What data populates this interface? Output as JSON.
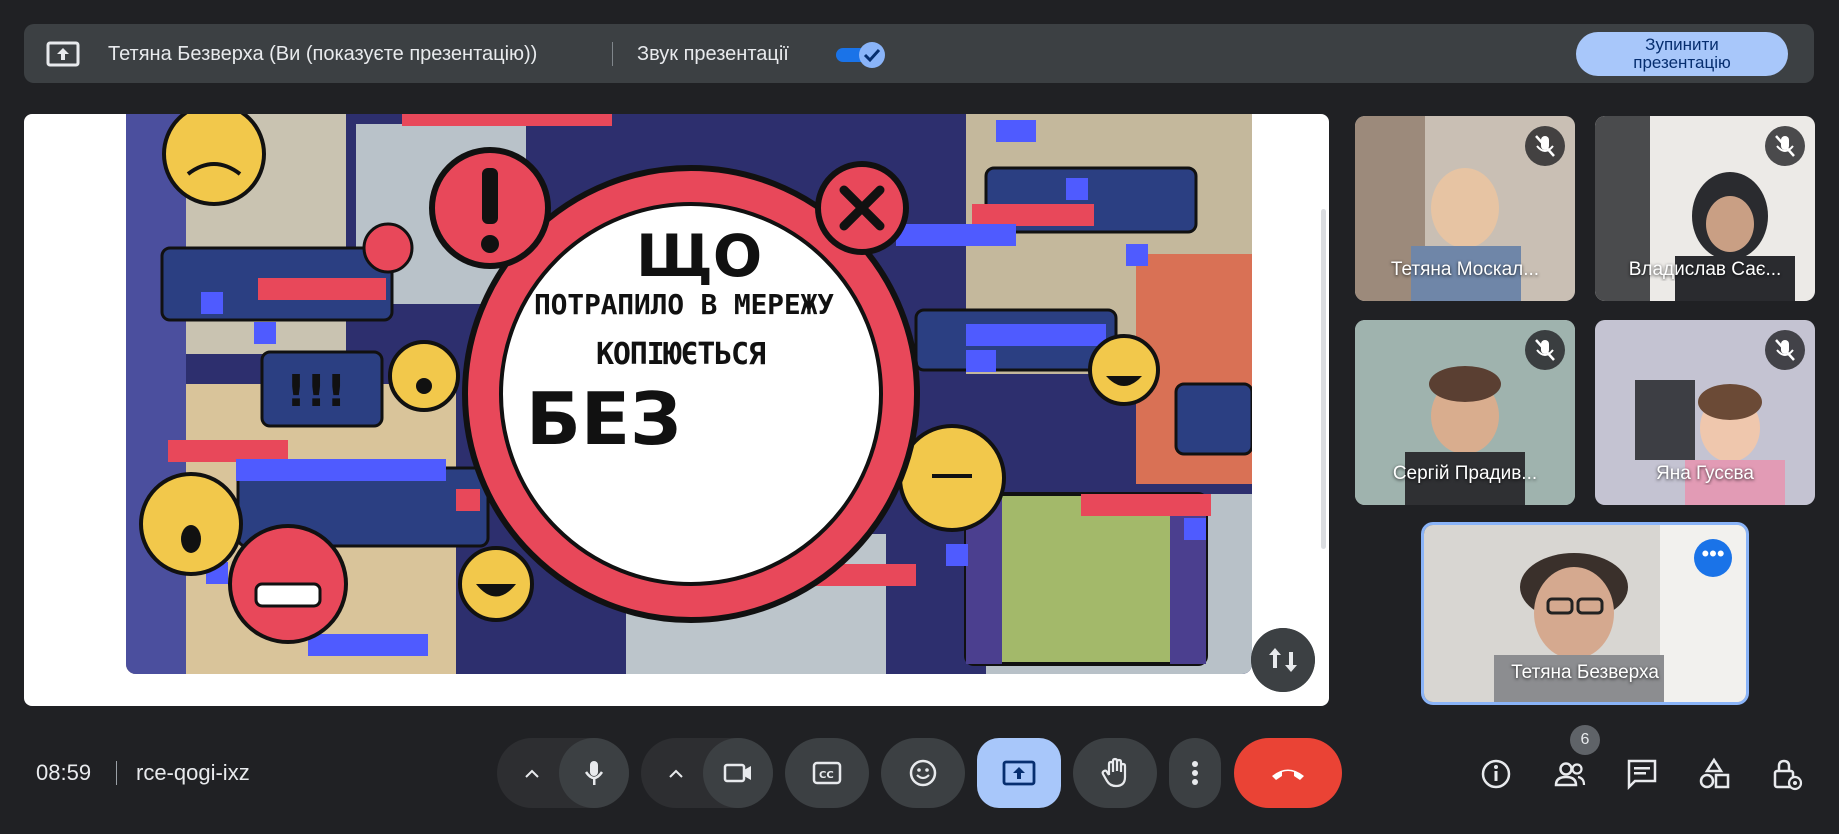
{
  "topbar": {
    "presenting_title": "Тетяна Безверха (Ви (показуєте презентацію))",
    "sound_label": "Звук презентації",
    "sound_on": true,
    "stop_button": "Зупинити\nпрезентацію",
    "icon": "present-screen-icon"
  },
  "slide": {
    "line1": "ЩО",
    "line2": "ПОТРАПИЛО В МЕРЕЖУ",
    "line3": "КОПІЮЄТЬСЯ",
    "line4": "БЕЗ",
    "bubble_exclaim": "!!!",
    "colors": {
      "red": "#e8485a",
      "navy": "#2d2f6e",
      "blue": "#4f5bff",
      "yellow": "#f2c84b"
    }
  },
  "participants": [
    {
      "name": "Тетяна Москал...",
      "muted": true
    },
    {
      "name": "Владислав Сає...",
      "muted": true
    },
    {
      "name": "Сергій Прадив...",
      "muted": true
    },
    {
      "name": "Яна Гусєва",
      "muted": true
    }
  ],
  "self": {
    "name": "Тетяна Безверха",
    "more_icon": "more-horiz-icon"
  },
  "bottombar": {
    "time": "08:59",
    "meeting_code": "rce-qogi-ixz",
    "people_count": "6",
    "controls": [
      "mic-icon",
      "camera-icon",
      "captions-icon",
      "emoji-icon",
      "present-icon",
      "raise-hand-icon",
      "more-vert-icon",
      "hangup-icon"
    ],
    "right_icons": [
      "info-icon",
      "people-icon",
      "chat-icon",
      "activities-icon",
      "host-controls-icon"
    ]
  }
}
